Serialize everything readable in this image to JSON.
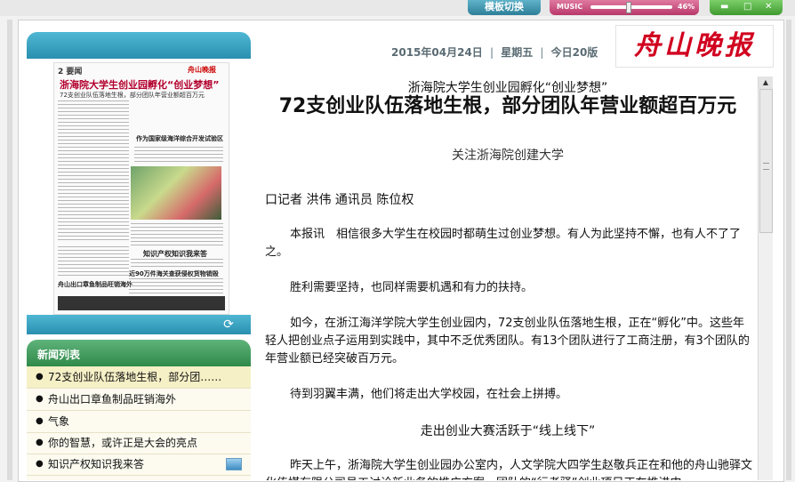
{
  "toolbar": {
    "switch_label": "模板切换",
    "music_label": "MUSIC",
    "volume_text": "46%",
    "volume_level": 0.46,
    "min_label": "▬",
    "max_label": "□",
    "close_label": "✕"
  },
  "thumbnail": {
    "page_num": "2",
    "page_label": "要闻",
    "masthead": "舟山晚报",
    "title": "浙海院大学生创业园孵化“创业梦想”",
    "subtitle": "72支创业队伍落地生根，部分团队年营业额超百万元",
    "headline2": "作为国家级海洋综合开发试验区 你的智慧，或许正是大会的亮点",
    "caption": "知识产权知识我来答",
    "caption2": "近90万件海关查获侵权货物销毁",
    "caption3": "舟山出口章鱼制品旺销海外"
  },
  "news": {
    "header": "新闻列表",
    "items": [
      {
        "label": "72支创业队伍落地生根，部分团……",
        "selected": true
      },
      {
        "label": "舟山出口章鱼制品旺销海外",
        "selected": false
      },
      {
        "label": "气象",
        "selected": false
      },
      {
        "label": "你的智慧，或许正是大会的亮点",
        "selected": false
      },
      {
        "label": "知识产权知识我来答",
        "selected": false
      }
    ]
  },
  "header": {
    "date": "2015年04月24日",
    "weekday": "星期五",
    "pages": "今日20版",
    "logo": "舟山晚报"
  },
  "article": {
    "intro": "浙海院大学生创业园孵化“创业梦想”",
    "title": "72支创业队伍落地生根，部分团队年营业额超百万元",
    "subtitle": "关注浙海院创建大学",
    "author": "口记者 洪伟 通讯员 陈位权",
    "paragraphs": [
      "本报讯　相信很多大学生在校园时都萌生过创业梦想。有人为此坚持不懈，也有人不了了之。",
      "胜利需要坚持，也同样需要机遇和有力的扶持。",
      "如今，在浙江海洋学院大学生创业园内，72支创业队伍落地生根，正在“孵化”中。这些年轻人把创业点子运用到实践中，其中不乏优秀团队。有13个团队进行了工商注册，有3个团队的年营业额已经突破百万元。",
      "待到羽翼丰满，他们将走出大学校园，在社会上拼搏。"
    ],
    "section_heading": "走出创业大赛活跃于“线上线下”",
    "last_paragraph": "昨天上午，浙海院大学生创业园办公室内，人文学院大四学生赵敬兵正在和他的舟山驰驿文化传媒有限公司员工讨论新业务的推广方案，团队的“行者驿”创业项目正在推进中。"
  }
}
